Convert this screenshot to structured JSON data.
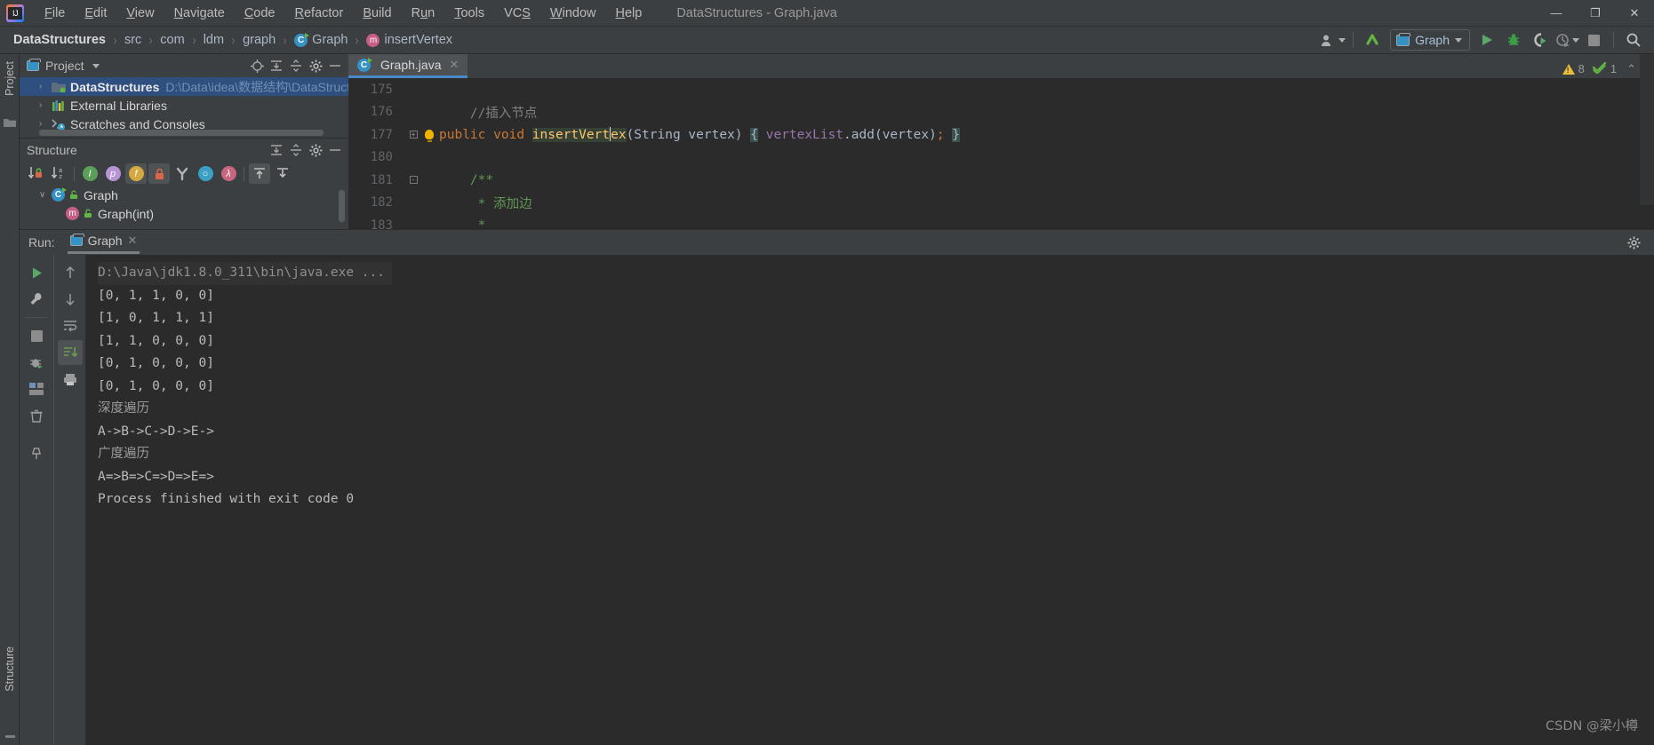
{
  "window": {
    "title": "DataStructures - Graph.java",
    "controls": {
      "minimize": "—",
      "maximize": "❐",
      "close": "✕"
    }
  },
  "menubar": {
    "logo_text": "IJ",
    "items": [
      {
        "label": "File",
        "mnemonic": "F"
      },
      {
        "label": "Edit",
        "mnemonic": "E"
      },
      {
        "label": "View",
        "mnemonic": "V"
      },
      {
        "label": "Navigate",
        "mnemonic": "N"
      },
      {
        "label": "Code",
        "mnemonic": "C"
      },
      {
        "label": "Refactor",
        "mnemonic": "R"
      },
      {
        "label": "Build",
        "mnemonic": "B"
      },
      {
        "label": "Run",
        "mnemonic": "u"
      },
      {
        "label": "Tools",
        "mnemonic": "T"
      },
      {
        "label": "VCS",
        "mnemonic": "S"
      },
      {
        "label": "Window",
        "mnemonic": "W"
      },
      {
        "label": "Help",
        "mnemonic": "H"
      }
    ]
  },
  "navbar": {
    "breadcrumbs": [
      {
        "label": "DataStructures",
        "icon": ""
      },
      {
        "label": "src",
        "icon": ""
      },
      {
        "label": "com",
        "icon": ""
      },
      {
        "label": "ldm",
        "icon": ""
      },
      {
        "label": "graph",
        "icon": ""
      },
      {
        "label": "Graph",
        "icon": "class-icon"
      },
      {
        "label": "insertVertex",
        "icon": "method-icon"
      }
    ],
    "separator": "›",
    "run_config": "Graph",
    "buttons": [
      "user-account-icon",
      "vcs-update-icon",
      "run-button",
      "debug-button",
      "run-coverage-button",
      "profile-button",
      "stop-button",
      "search-everywhere-icon"
    ]
  },
  "left_strip": {
    "project_label": "Project",
    "structure_label": "Structure"
  },
  "project_panel": {
    "title": "Project",
    "head_icons": [
      "locate-icon",
      "expand-all-icon",
      "collapse-all-icon",
      "gear-icon",
      "hide-icon"
    ],
    "tree": [
      {
        "name": "DataStructures",
        "path": "D:\\Data\\idea\\数据结构\\DataStructure",
        "arrow": "›",
        "selected": true,
        "icon": "module-icon"
      },
      {
        "name": "External Libraries",
        "path": "",
        "arrow": "›",
        "selected": false,
        "icon": "libraries-icon"
      },
      {
        "name": "Scratches and Consoles",
        "path": "",
        "arrow": "›",
        "selected": false,
        "icon": "scratches-icon"
      }
    ]
  },
  "structure_panel": {
    "title": "Structure",
    "head_icons": [
      "expand-all-icon",
      "collapse-all-icon",
      "gear-icon",
      "hide-icon"
    ],
    "toolbar": [
      "sort-by-visibility-icon",
      "sort-alphabetically-icon",
      "show-inherited-icon",
      "show-properties-icon",
      "show-fields-icon",
      "show-non-public-icon",
      "group-methods-icon",
      "show-anonymous-icon",
      "show-lambdas-icon",
      "scroll-from-source-icon",
      "scroll-to-source-icon"
    ],
    "tree": [
      {
        "name": "Graph",
        "arrow": "∨",
        "kind": "class"
      },
      {
        "name": "Graph(int)",
        "arrow": "",
        "kind": "method"
      }
    ]
  },
  "editor": {
    "tab": {
      "label": "Graph.java",
      "close": "✕"
    },
    "warnings": {
      "warn_count": "8",
      "ok_count": "1",
      "collapse": "⌃"
    },
    "lines": [
      {
        "num": "175",
        "fold": "",
        "bulb": false,
        "tokens": []
      },
      {
        "num": "176",
        "fold": "",
        "bulb": false,
        "tokens": [
          {
            "t": "    ",
            "c": "punct"
          },
          {
            "t": "//插入节点",
            "c": "cmt"
          }
        ]
      },
      {
        "num": "177",
        "fold": "+",
        "bulb": true,
        "tokens": [
          {
            "t": "public",
            "c": "kw"
          },
          {
            "t": " ",
            "c": "punct"
          },
          {
            "t": "void",
            "c": "kw"
          },
          {
            "t": " ",
            "c": "punct"
          },
          {
            "t": "insertVert",
            "c": "mname hl-ident"
          },
          {
            "t": "|",
            "c": "caret"
          },
          {
            "t": "ex",
            "c": "mname hl-ident"
          },
          {
            "t": "(",
            "c": "punct"
          },
          {
            "t": "String",
            "c": "typ"
          },
          {
            "t": " vertex)",
            "c": "punct"
          },
          {
            "t": " ",
            "c": "punct"
          },
          {
            "t": "{",
            "c": "punct hl-brace"
          },
          {
            "t": " ",
            "c": "punct"
          },
          {
            "t": "vertexList",
            "c": "fld"
          },
          {
            "t": ".add(vertex)",
            "c": "typ"
          },
          {
            "t": ";",
            "c": "kw"
          },
          {
            "t": " ",
            "c": "punct"
          },
          {
            "t": "}",
            "c": "punct hl-brace"
          }
        ]
      },
      {
        "num": "180",
        "fold": "",
        "bulb": false,
        "tokens": []
      },
      {
        "num": "181",
        "fold": "-",
        "bulb": false,
        "tokens": [
          {
            "t": "    ",
            "c": "punct"
          },
          {
            "t": "/**",
            "c": "doc"
          }
        ]
      },
      {
        "num": "182",
        "fold": "",
        "bulb": false,
        "tokens": [
          {
            "t": "     ",
            "c": "punct"
          },
          {
            "t": "* 添加边",
            "c": "doc"
          }
        ]
      },
      {
        "num": "183",
        "fold": "",
        "bulb": false,
        "tokens": [
          {
            "t": "     ",
            "c": "punct"
          },
          {
            "t": "*",
            "c": "doc"
          }
        ]
      }
    ]
  },
  "run_panel": {
    "label": "Run:",
    "tab": {
      "label": "Graph",
      "close": "✕"
    },
    "gear_icon": "gear-icon",
    "left_buttons": [
      "rerun-icon",
      "settings-wrench-icon",
      "stop-icon",
      "debug-icon",
      "layout-icon",
      "trash-icon",
      "pin-icon"
    ],
    "console_buttons": [
      "scroll-up-icon",
      "scroll-down-icon",
      "soft-wrap-icon",
      "scroll-to-end-icon",
      "print-icon"
    ],
    "console_lines": [
      {
        "text": "D:\\Java\\jdk1.8.0_311\\bin\\java.exe ...",
        "style": "cmd"
      },
      {
        "text": "[0, 1, 1, 0, 0]",
        "style": "out"
      },
      {
        "text": "[1, 0, 1, 1, 1]",
        "style": "out"
      },
      {
        "text": "[1, 1, 0, 0, 0]",
        "style": "out"
      },
      {
        "text": "[0, 1, 0, 0, 0]",
        "style": "out"
      },
      {
        "text": "[0, 1, 0, 0, 0]",
        "style": "out"
      },
      {
        "text": "深度遍历",
        "style": "cn"
      },
      {
        "text": "A->B->C->D->E->",
        "style": "out"
      },
      {
        "text": "广度遍历",
        "style": "cn"
      },
      {
        "text": "A=>B=>C=>D=>E=>",
        "style": "out"
      },
      {
        "text": "Process finished with exit code 0",
        "style": "out"
      }
    ]
  },
  "watermark": "CSDN @梁小樽",
  "colors": {
    "accent_blue": "#4a88c7",
    "selection": "#2f4f7f",
    "keyword_orange": "#cc7832",
    "method_yellow": "#ffc66d",
    "field_purple": "#9876aa",
    "doc_green": "#629755",
    "warn_yellow": "#e8bf36",
    "ok_green": "#62b543"
  }
}
